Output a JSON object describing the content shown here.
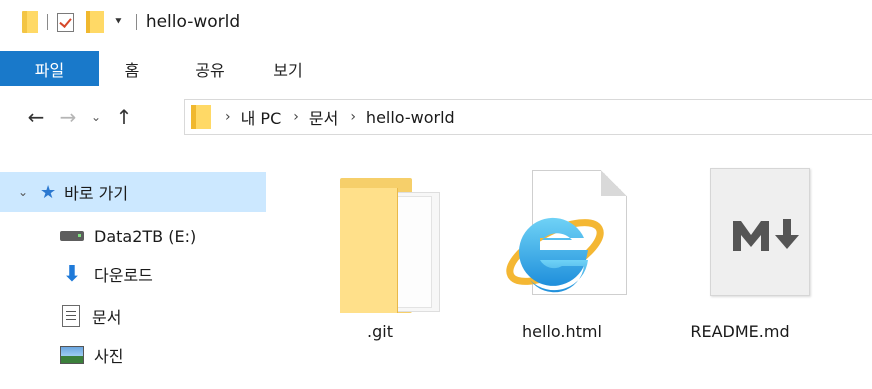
{
  "titlebar": {
    "title": "hello-world",
    "dropdown": "⯆"
  },
  "ribbon": {
    "file": "파일",
    "tabs": [
      "홈",
      "공유",
      "보기"
    ]
  },
  "nav": {
    "back": "←",
    "forward": "→",
    "recent": "⌄",
    "up": "↑"
  },
  "address": {
    "separator": "›",
    "crumbs": [
      "내 PC",
      "문서",
      "hello-world"
    ]
  },
  "sidebar": {
    "items": [
      {
        "label": "바로 가기",
        "icon": "star-icon",
        "selected": true
      },
      {
        "label": "Data2TB (E:)",
        "icon": "drive-icon"
      },
      {
        "label": "다운로드",
        "icon": "download-icon"
      },
      {
        "label": "문서",
        "icon": "documents-icon"
      },
      {
        "label": "사진",
        "icon": "pictures-icon"
      }
    ]
  },
  "files": [
    {
      "name": ".git",
      "icon": "folder-icon"
    },
    {
      "name": "hello.html",
      "icon": "internet-explorer-icon"
    },
    {
      "name": "README.md",
      "icon": "markdown-icon"
    }
  ],
  "colors": {
    "accent": "#1979ca",
    "selection": "#cce8ff",
    "folder": "#ffd966"
  }
}
